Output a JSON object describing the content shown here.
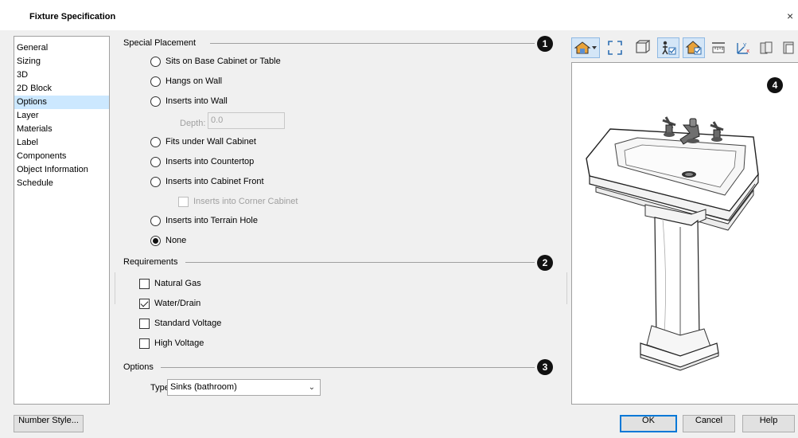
{
  "window": {
    "title": "Fixture Specification",
    "close_glyph": "×"
  },
  "nav": {
    "items": [
      {
        "label": "General"
      },
      {
        "label": "Sizing"
      },
      {
        "label": "3D"
      },
      {
        "label": "2D Block"
      },
      {
        "label": "Options",
        "selected": true
      },
      {
        "label": "Layer"
      },
      {
        "label": "Materials"
      },
      {
        "label": "Label"
      },
      {
        "label": "Components"
      },
      {
        "label": "Object Information"
      },
      {
        "label": "Schedule"
      }
    ]
  },
  "special_placement": {
    "header": "Special Placement",
    "badge": "1",
    "options": [
      {
        "label": "Sits on Base Cabinet or Table",
        "checked": false
      },
      {
        "label": "Hangs on Wall",
        "checked": false
      },
      {
        "label": "Inserts into Wall",
        "checked": false
      },
      {
        "label": "Fits under Wall Cabinet",
        "checked": false
      },
      {
        "label": "Inserts into Countertop",
        "checked": false
      },
      {
        "label": "Inserts into Cabinet Front",
        "checked": false
      },
      {
        "label": "Inserts into Terrain Hole",
        "checked": false
      },
      {
        "label": "None",
        "checked": true
      }
    ],
    "depth_label": "Depth:",
    "depth_value": "0.0",
    "corner_cabinet_label": "Inserts into Corner Cabinet"
  },
  "requirements": {
    "header": "Requirements",
    "badge": "2",
    "items": [
      {
        "label": "Natural Gas",
        "checked": false
      },
      {
        "label": "Water/Drain",
        "checked": true
      },
      {
        "label": "Standard Voltage",
        "checked": false
      },
      {
        "label": "High Voltage",
        "checked": false
      }
    ]
  },
  "options": {
    "header": "Options",
    "badge": "3",
    "type_label": "Type:",
    "type_value": "Sinks (bathroom)"
  },
  "preview": {
    "badge": "4"
  },
  "toolbar": {
    "icons": [
      "render-mode-icon",
      "fill-window-icon",
      "orbit-icon",
      "camera-icon",
      "color-icon",
      "ruler-icon",
      "axes-icon",
      "layers-icon",
      "view-options-icon"
    ]
  },
  "buttons": {
    "number_style": "Number Style...",
    "ok": "OK",
    "cancel": "Cancel",
    "help": "Help"
  },
  "colors": {
    "selected_bg": "#cce8ff",
    "toolbar_active": "#d4e6f7",
    "default_button_border": "#0078d7"
  }
}
